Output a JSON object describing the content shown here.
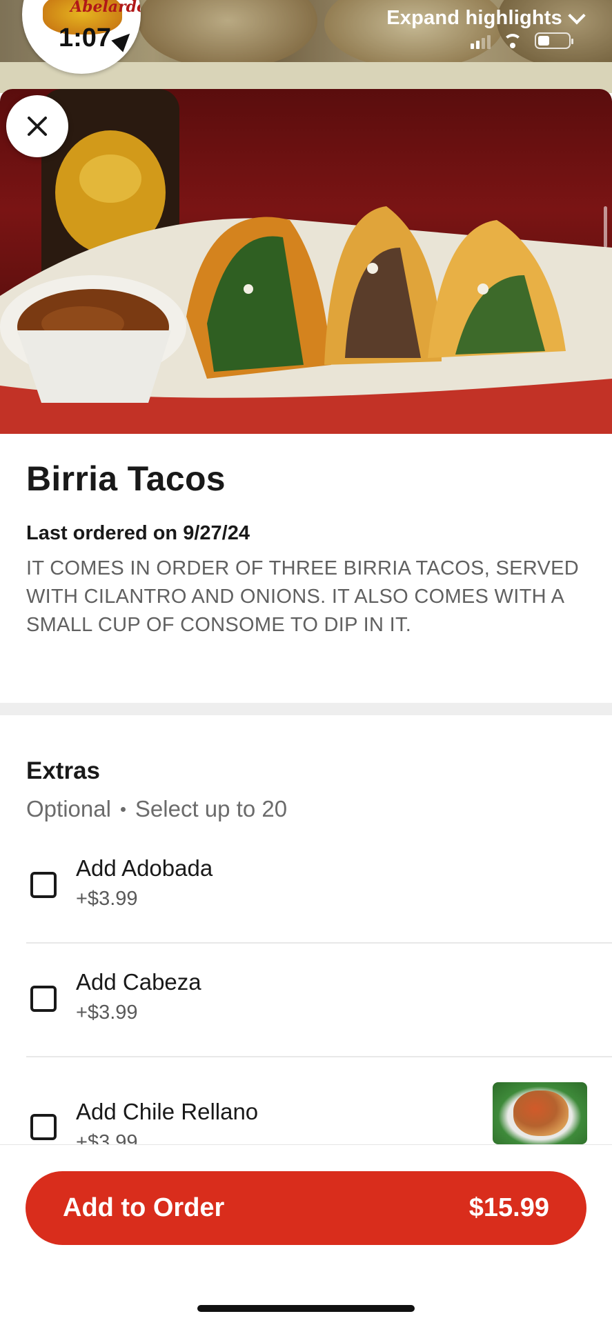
{
  "status_bar": {
    "time": "1:07"
  },
  "restaurant": {
    "logo_text": "Abelardo's"
  },
  "header": {
    "expand_label": "Expand highlights"
  },
  "item": {
    "title": "Birria Tacos",
    "last_ordered": "Last ordered on 9/27/24",
    "description": "IT COMES IN ORDER OF THREE BIRRIA TACOS, SERVED WITH CILANTRO AND ONIONS. IT ALSO COMES WITH A SMALL CUP OF CONSOME TO DIP IN IT."
  },
  "extras": {
    "title": "Extras",
    "optional": "Optional",
    "limit": "Select up to 20",
    "options": [
      {
        "name": "Add Adobada",
        "price": "+$3.99",
        "checked": false
      },
      {
        "name": "Add Cabeza",
        "price": "+$3.99",
        "checked": false
      },
      {
        "name": "Add Chile Rellano",
        "price": "+$3.99",
        "checked": false
      }
    ]
  },
  "footer": {
    "add_label": "Add to Order",
    "price": "$15.99"
  },
  "colors": {
    "accent": "#d92d1c",
    "text": "#191919",
    "muted": "#606060"
  },
  "icons": [
    "close-icon",
    "chevron-down-icon",
    "location-arrow-icon",
    "signal-icon",
    "wifi-icon",
    "battery-icon",
    "checkbox-icon"
  ]
}
